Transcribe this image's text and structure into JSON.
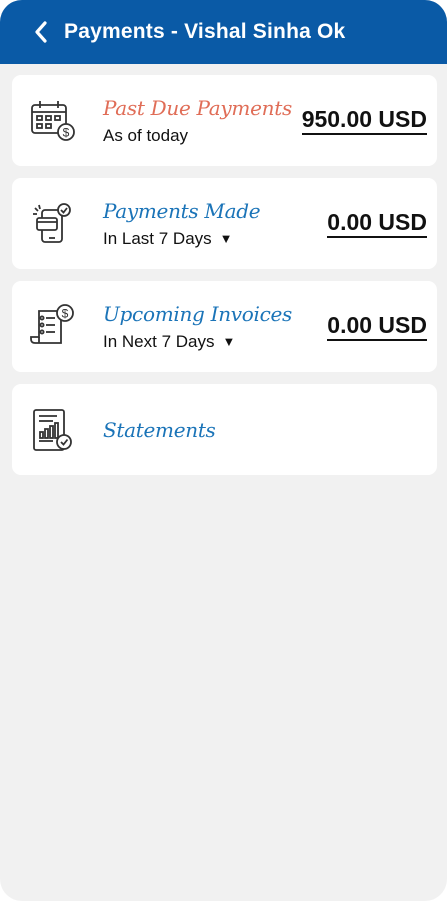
{
  "header": {
    "back_icon": "chevron-left-icon",
    "title": "Payments - Vishal Sinha Ok"
  },
  "cards": [
    {
      "title": "Past Due Payments",
      "subtitle": "As of today",
      "amount": "950.00 USD",
      "icon": "calendar-dollar-icon",
      "title_color": "#e06d57"
    },
    {
      "title": "Payments Made",
      "subtitle": "In Last 7 Days",
      "dropdown_icon": "caret-down-icon",
      "caret": "▼",
      "amount": "0.00 USD",
      "icon": "mobile-card-check-icon",
      "title_color": "#1b74b8"
    },
    {
      "title": "Upcoming Invoices",
      "subtitle": "In Next 7 Days",
      "dropdown_icon": "caret-down-icon",
      "caret": "▼",
      "amount": "0.00 USD",
      "icon": "invoice-dollar-icon",
      "title_color": "#1b74b8"
    },
    {
      "title": "Statements",
      "icon": "statement-chart-check-icon",
      "title_color": "#1b74b8"
    }
  ],
  "colors": {
    "header_bg": "#0a5aa6",
    "page_bg": "#f1f1f1",
    "card_bg": "#ffffff"
  }
}
